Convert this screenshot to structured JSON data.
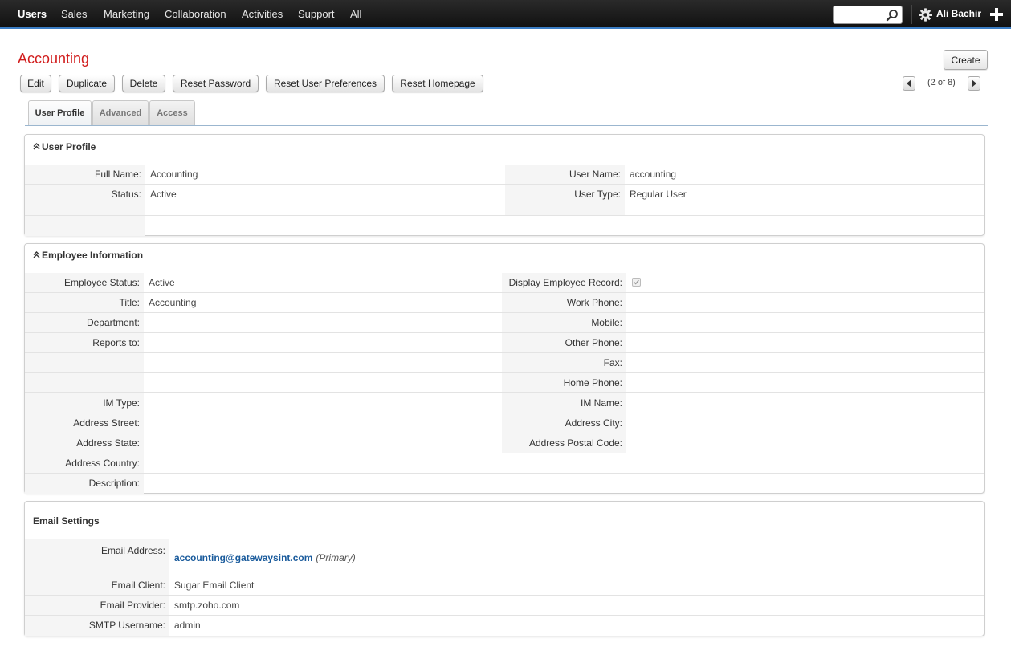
{
  "nav": {
    "items": [
      "Users",
      "Sales",
      "Marketing",
      "Collaboration",
      "Activities",
      "Support",
      "All"
    ],
    "user_name": "Ali Bachir",
    "accent_color": "#3b7dc4"
  },
  "record": {
    "title": "Accounting",
    "create_label": "Create",
    "actions": [
      "Edit",
      "Duplicate",
      "Delete",
      "Reset Password",
      "Reset User Preferences",
      "Reset Homepage"
    ],
    "pager": "(2 of 8)"
  },
  "tabs": [
    "User Profile",
    "Advanced",
    "Access"
  ],
  "user_profile": {
    "title": "User Profile",
    "full_name_label": "Full Name:",
    "full_name": "Accounting",
    "user_name_label": "User Name:",
    "user_name": "accounting",
    "status_label": "Status:",
    "status": "Active",
    "user_type_label": "User Type:",
    "user_type": "Regular User"
  },
  "employee": {
    "title": "Employee Information",
    "employee_status_label": "Employee Status:",
    "employee_status": "Active",
    "display_record_label": "Display Employee Record:",
    "title_label": "Title:",
    "title_value": "Accounting",
    "work_phone_label": "Work Phone:",
    "department_label": "Department:",
    "mobile_label": "Mobile:",
    "reports_to_label": "Reports to:",
    "other_phone_label": "Other Phone:",
    "fax_label": "Fax:",
    "home_phone_label": "Home Phone:",
    "im_type_label": "IM Type:",
    "im_name_label": "IM Name:",
    "address_street_label": "Address Street:",
    "address_city_label": "Address City:",
    "address_state_label": "Address State:",
    "address_postal_label": "Address Postal Code:",
    "address_country_label": "Address Country:",
    "description_label": "Description:"
  },
  "email": {
    "title": "Email Settings",
    "address_label": "Email Address:",
    "address": "accounting@gatewaysint.com",
    "primary_tag": "(Primary)",
    "client_label": "Email Client:",
    "client": "Sugar Email Client",
    "provider_label": "Email Provider:",
    "provider": "smtp.zoho.com",
    "smtp_label": "SMTP Username:",
    "smtp_username": "admin"
  }
}
